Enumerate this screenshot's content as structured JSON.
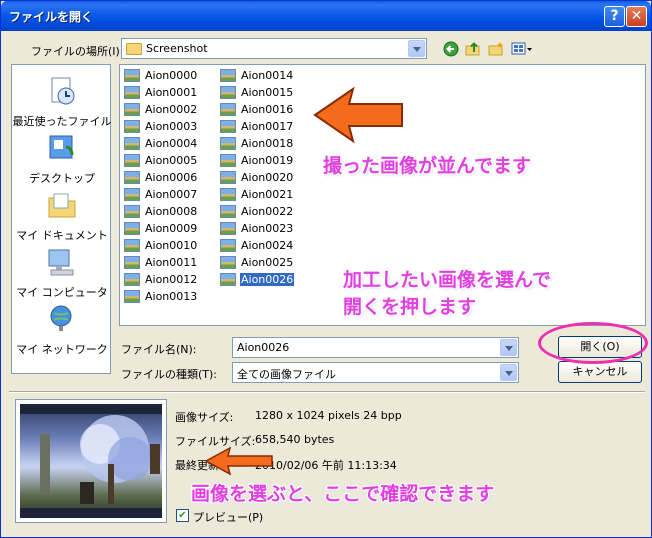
{
  "titlebar": {
    "title": "ファイルを開く",
    "help": "?",
    "close": "✕"
  },
  "location": {
    "label": "ファイルの場所(I):",
    "value": "Screenshot"
  },
  "places": [
    {
      "label": "最近使ったファイル",
      "icon": "recent-documents-icon"
    },
    {
      "label": "デスクトップ",
      "icon": "desktop-icon"
    },
    {
      "label": "マイ ドキュメント",
      "icon": "my-documents-icon"
    },
    {
      "label": "マイ コンピュータ",
      "icon": "my-computer-icon"
    },
    {
      "label": "マイ ネットワーク",
      "icon": "my-network-icon"
    }
  ],
  "files_col1": [
    "Aion0000",
    "Aion0001",
    "Aion0002",
    "Aion0003",
    "Aion0004",
    "Aion0005",
    "Aion0006",
    "Aion0007",
    "Aion0008",
    "Aion0009",
    "Aion0010",
    "Aion0011",
    "Aion0012",
    "Aion0013"
  ],
  "files_col2": [
    "Aion0014",
    "Aion0015",
    "Aion0016",
    "Aion0017",
    "Aion0018",
    "Aion0019",
    "Aion0020",
    "Aion0021",
    "Aion0022",
    "Aion0023",
    "Aion0024",
    "Aion0025",
    "Aion0026"
  ],
  "selected_file": "Aion0026",
  "filename": {
    "label": "ファイル名(N):",
    "value": "Aion0026"
  },
  "filetype": {
    "label": "ファイルの種類(T):",
    "value": "全ての画像ファイル"
  },
  "buttons": {
    "open": "開く(O)",
    "cancel": "キャンセル"
  },
  "info": {
    "size_label": "画像サイズ:",
    "size_value": "1280 x 1024 pixels 24 bpp",
    "file_label": "ファイルサイズ:",
    "file_value": "658,540 bytes",
    "date_label": "最終更新:",
    "date_value": "2010/02/06 午前 11:13:34"
  },
  "preview": {
    "label": "プレビュー(P)",
    "checked": true
  },
  "annotations": {
    "a1": "撮った画像が並んでます",
    "a2_line1": "加工したい画像を選んで",
    "a2_line2": "開くを押します",
    "a3": "画像を選ぶと、ここで確認できます"
  }
}
